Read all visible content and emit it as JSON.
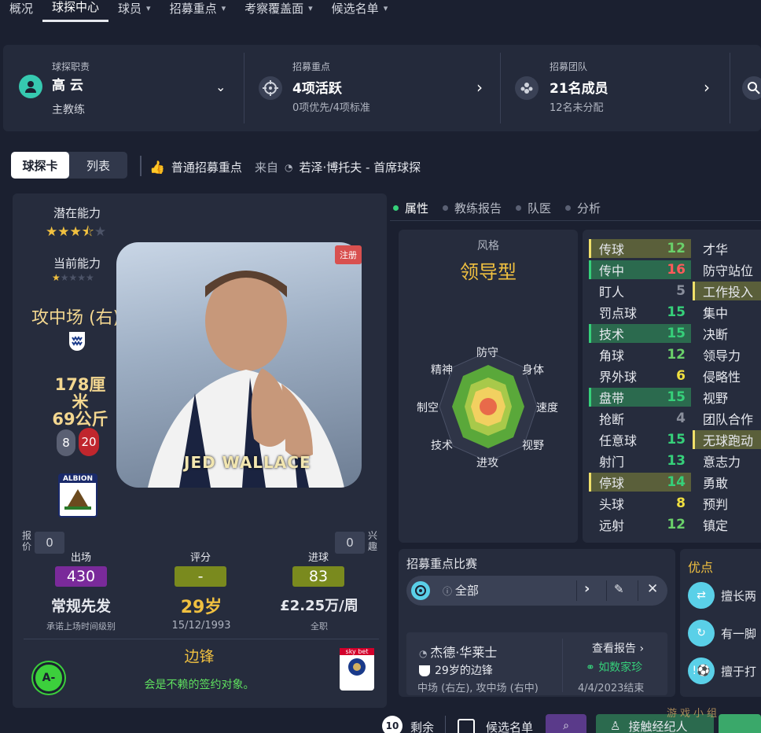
{
  "nav": {
    "items": [
      {
        "label": "概况",
        "chevron": false
      },
      {
        "label": "球探中心",
        "chevron": false,
        "active": true
      },
      {
        "label": "球员",
        "chevron": true
      },
      {
        "label": "招募重点",
        "chevron": true
      },
      {
        "label": "考察覆盖面",
        "chevron": true
      },
      {
        "label": "候选名单",
        "chevron": true
      }
    ]
  },
  "header": {
    "scout": {
      "caption": "球探职责",
      "name": "高 云",
      "role": "主教练"
    },
    "focus": {
      "caption": "招募重点",
      "value": "4项活跃",
      "sub": "0项优先/4项标准"
    },
    "team": {
      "caption": "招募团队",
      "value": "21名成员",
      "sub": "12名未分配"
    }
  },
  "toggle": {
    "card": "球探卡",
    "list": "列表"
  },
  "recruit_line": {
    "label": "普通招募重点",
    "from": "来自",
    "source": "若泽·博托夫 - 首席球探"
  },
  "player": {
    "potential_label": "潜在能力",
    "current_label": "当前能力",
    "position": "攻中场 (右)",
    "height": "178厘米",
    "weight": "69公斤",
    "foot_left": "8",
    "foot_right": "20",
    "registered": "注册",
    "shirt_name": "JED WALLACE",
    "offer_label": "报价",
    "offer_value": "0",
    "interest_label": "兴趣",
    "interest_value": "0",
    "apps_label": "出场",
    "apps_value": "430",
    "rating_label": "评分",
    "rating_value": "-",
    "goals_label": "进球",
    "goals_value": "83",
    "status": "常规先发",
    "status_sub": "承诺上场时间级别",
    "age": "29岁",
    "dob": "15/12/1993",
    "wage": "£2.25万/周",
    "wage_sub": "全职",
    "role": "边锋",
    "grade": "A-",
    "verdict": "会是不赖的签约对象。",
    "colors": {
      "gold": "#f0c040",
      "green": "#36d07a",
      "purple": "#7a2a9a",
      "olive": "#7a8a1e"
    }
  },
  "tabs": [
    {
      "label": "属性",
      "active": true
    },
    {
      "label": "教练报告"
    },
    {
      "label": "队医"
    },
    {
      "label": "分析"
    }
  ],
  "style": {
    "caption": "风格",
    "value": "领导型",
    "radar_labels": [
      "防守",
      "身体",
      "速度",
      "视野",
      "进攻",
      "技术",
      "制空",
      "精神"
    ]
  },
  "attributes_left": [
    {
      "name": "传球",
      "value": "12",
      "hl": "olive"
    },
    {
      "name": "传中",
      "value": "16",
      "hl": "green"
    },
    {
      "name": "盯人",
      "value": "5"
    },
    {
      "name": "罚点球",
      "value": "15"
    },
    {
      "name": "技术",
      "value": "15",
      "hl": "green"
    },
    {
      "name": "角球",
      "value": "12"
    },
    {
      "name": "界外球",
      "value": "6"
    },
    {
      "name": "盘带",
      "value": "15",
      "hl": "green"
    },
    {
      "name": "抢断",
      "value": "4"
    },
    {
      "name": "任意球",
      "value": "15"
    },
    {
      "name": "射门",
      "value": "13"
    },
    {
      "name": "停球",
      "value": "14",
      "hl": "olive"
    },
    {
      "name": "头球",
      "value": "8"
    },
    {
      "name": "远射",
      "value": "12"
    }
  ],
  "attributes_right": [
    {
      "name": "才华"
    },
    {
      "name": "防守站位"
    },
    {
      "name": "盯人工作投入",
      "display": "工作投入",
      "hl": "olive"
    },
    {
      "name": "集中"
    },
    {
      "name": "决断"
    },
    {
      "name": "领导力"
    },
    {
      "name": "侵略性"
    },
    {
      "name": "视野"
    },
    {
      "name": "团队合作"
    },
    {
      "name": "无球跑动",
      "hl": "olive"
    },
    {
      "name": "意志力"
    },
    {
      "name": "勇敢"
    },
    {
      "name": "预判"
    },
    {
      "name": "镇定"
    }
  ],
  "match": {
    "title": "招募重点比赛",
    "filter": "全部",
    "scout_name": "杰德·华莱士",
    "desc": "29岁的边锋",
    "positions": "中场 (右左), 攻中场 (右中)",
    "view_report": "查看报告",
    "gem": "如数家珍",
    "contract": "4/4/2023结束"
  },
  "advantages": {
    "title": "优点",
    "items": [
      "擅长两",
      "有一脚",
      "擅于打"
    ]
  },
  "bottom": {
    "remaining_count": "10",
    "remaining_label": "剩余",
    "shortlist": "候选名单",
    "contact_agent": "接触经纪人",
    "watermark": "游戏小组"
  }
}
